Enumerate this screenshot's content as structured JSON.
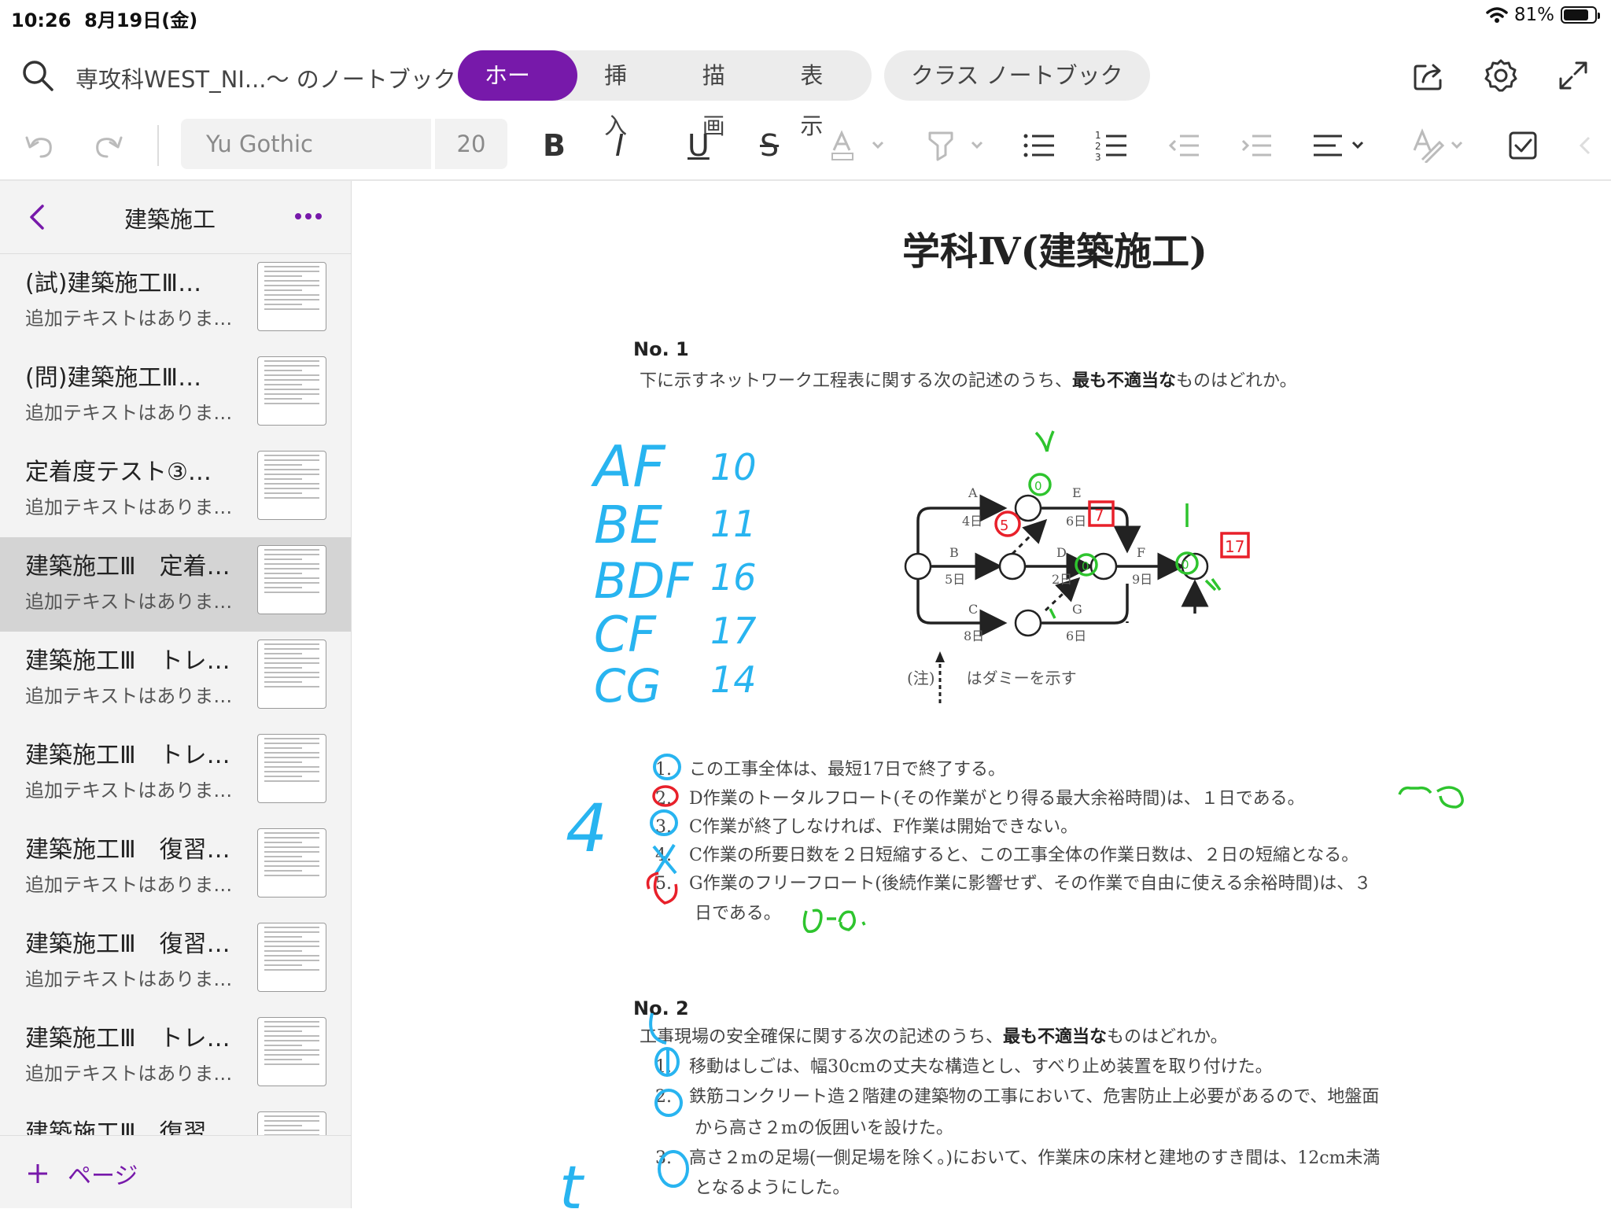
{
  "status": {
    "time": "10:26",
    "date": "8月19日(金)",
    "battery": "81%",
    "battery_level": 0.81
  },
  "nav": {
    "notebook": "専攻科WEST_NI...〜 のノートブック",
    "tabs": [
      "ホーム",
      "挿入",
      "描画",
      "表示"
    ],
    "active_tab": "ホーム",
    "class_notebook": "クラス ノートブック"
  },
  "toolbar": {
    "font": "Yu Gothic",
    "size": "20"
  },
  "section": {
    "title": "建築施工",
    "pages": [
      {
        "title": "(試)建築施工Ⅲ…",
        "sub": "追加テキストはありま…"
      },
      {
        "title": "(問)建築施工Ⅲ…",
        "sub": "追加テキストはありま…"
      },
      {
        "title": "定着度テスト③…",
        "sub": "追加テキストはありま…"
      },
      {
        "title": "建築施工Ⅲ　定着…",
        "sub": "追加テキストはありま…",
        "selected": true
      },
      {
        "title": "建築施工Ⅲ　トレ…",
        "sub": "追加テキストはありま…"
      },
      {
        "title": "建築施工Ⅲ　トレ…",
        "sub": "追加テキストはありま…"
      },
      {
        "title": "建築施工Ⅲ　復習…",
        "sub": "追加テキストはありま…"
      },
      {
        "title": "建築施工Ⅲ　復習…",
        "sub": "追加テキストはありま…"
      },
      {
        "title": "建築施工Ⅲ　トレ…",
        "sub": "追加テキストはありま…"
      },
      {
        "title": "建築施工Ⅲ　復習",
        "sub": ""
      }
    ],
    "add_page": "ページ"
  },
  "doc": {
    "title": "学科Ⅳ(建築施工)",
    "q1": {
      "no": "No. 1",
      "text_pre": "下に示すネットワーク工程表に関する次の記述のうち、",
      "text_bold": "最も不適当な",
      "text_post": "ものはどれか。",
      "diagram": {
        "A": "A",
        "A_days": "4日",
        "B": "B",
        "B_days": "5日",
        "C": "C",
        "C_days": "8日",
        "D": "D",
        "D_days": "2日",
        "E": "E",
        "E_days": "6日",
        "F": "F",
        "F_days": "9日",
        "G": "G",
        "G_days": "6日"
      },
      "note": "(注)　　はダミーを示す",
      "options": [
        "1.　この工事全体は、最短17日で終了する。",
        "2.　D作業のトータルフロート(その作業がとり得る最大余裕時間)は、１日である。",
        "3.　C作業が終了しなければ、F作業は開始できない。",
        "4.　C作業の所要日数を２日短縮すると、この工事全体の作業日数は、２日の短縮となる。",
        "5.　G作業のフリーフロート(後続作業に影響せず、その作業で自由に使える余裕時間)は、３",
        "日である。"
      ]
    },
    "q2": {
      "no": "No. 2",
      "text_pre": "工事現場の安全確保に関する次の記述のうち、",
      "text_bold": "最も不適当な",
      "text_post": "ものはどれか。",
      "options": [
        "1.　移動はしごは、幅30cmの丈夫な構造とし、すべり止め装置を取り付けた。",
        "2.　鉄筋コンクリート造２階建の建築物の工事において、危害防止上必要があるので、地盤面",
        "から高さ２mの仮囲いを設けた。",
        "3.　高さ２mの足場(一側足場を除く。)において、作業床の床材と建地のすき間は、12cm未満",
        "となるようにした。"
      ]
    }
  },
  "handwriting": {
    "paths": [
      "AF",
      "BE",
      "BDF",
      "CF",
      "CG"
    ],
    "durations": [
      "10",
      "11",
      "16",
      "17",
      "14"
    ],
    "answer_q1": "4",
    "answer_q2": "t"
  },
  "colors": {
    "accent": "#7719aa",
    "ink_blue": "#28b4f0",
    "ink_green": "#2ec42e",
    "ink_red": "#e8202a"
  }
}
